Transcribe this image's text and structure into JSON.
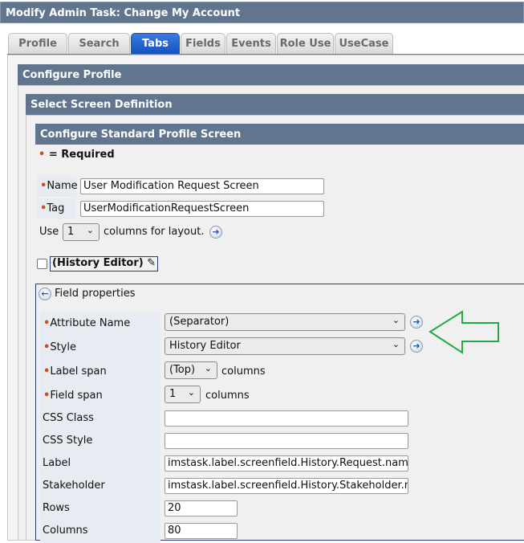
{
  "title": "Modify Admin Task: Change My Account",
  "tabs": [
    {
      "label": "Profile"
    },
    {
      "label": "Search"
    },
    {
      "label": "Tabs"
    },
    {
      "label": "Fields"
    },
    {
      "label": "Events"
    },
    {
      "label": "Role Use"
    },
    {
      "label": "UseCase"
    }
  ],
  "configure_profile": "Configure Profile",
  "select_screen": "Select Screen Definition",
  "configure_standard": "Configure Standard Profile Screen",
  "required_legend": "= Required",
  "name_label": "Name",
  "name_value": "User Modification Request Screen",
  "tag_label": "Tag",
  "tag_value": "UserModificationRequestScreen",
  "use_label": "Use",
  "columns_value": "1",
  "columns_suffix": "columns for layout.",
  "field_title": "(History Editor)",
  "field_properties": "Field properties",
  "fields": {
    "attribute_name": {
      "label": "Attribute Name",
      "value": "(Separator)"
    },
    "style": {
      "label": "Style",
      "value": "History Editor"
    },
    "label_span": {
      "label": "Label span",
      "value": "(Top)",
      "suffix": "columns"
    },
    "field_span": {
      "label": "Field span",
      "value": "1",
      "suffix": "columns"
    },
    "css_class": {
      "label": "CSS Class",
      "value": ""
    },
    "css_style": {
      "label": "CSS Style",
      "value": ""
    },
    "label": {
      "label": "Label",
      "value": "imstask.label.screenfield.History.Request.name"
    },
    "stakeholder": {
      "label": "Stakeholder",
      "value": "imstask.label.screenfield.History.Stakeholder.name"
    },
    "rows": {
      "label": "Rows",
      "value": "20"
    },
    "columns": {
      "label": "Columns",
      "value": "80"
    }
  },
  "colors": {
    "header": "#62758f",
    "active_tab": "#1a5fd0",
    "required": "#c8501e",
    "arrow": "#22aa44"
  }
}
